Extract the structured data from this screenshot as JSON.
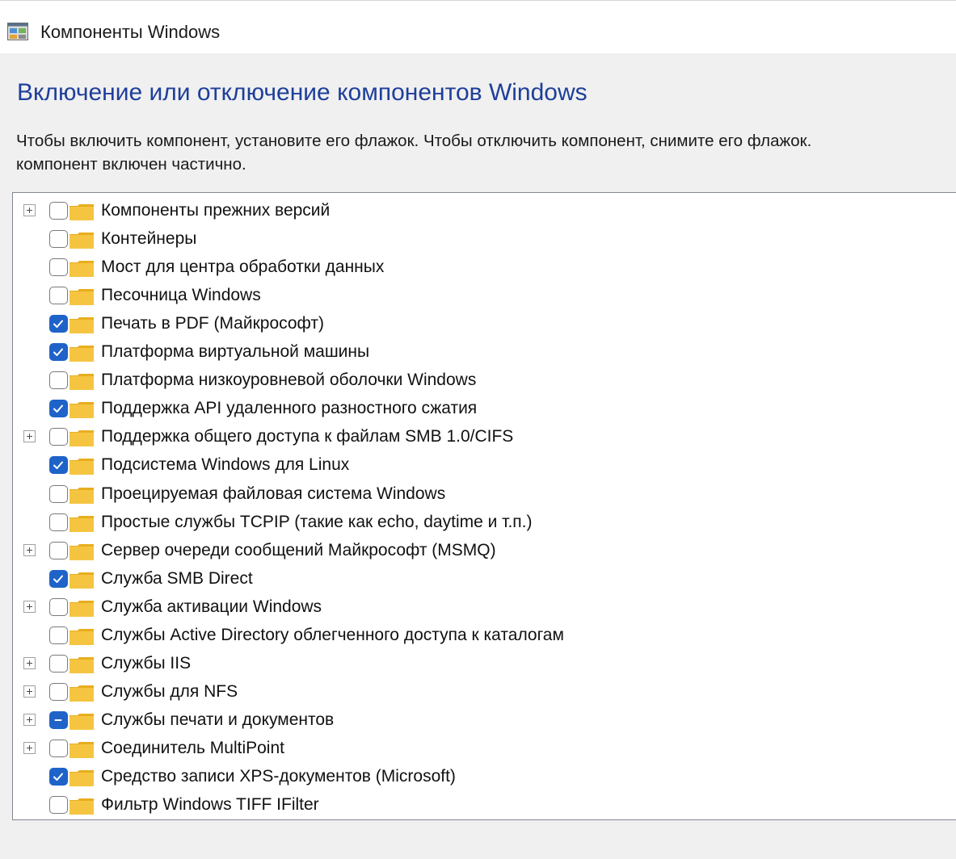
{
  "window": {
    "title": "Компоненты Windows",
    "icon": "windows-features-icon"
  },
  "heading": "Включение или отключение компонентов Windows",
  "description": {
    "line1": "Чтобы включить компонент, установите его флажок. Чтобы отключить компонент, снимите его флажок.",
    "line2": "компонент включен частично."
  },
  "colors": {
    "heading": "#1e3f9a",
    "checkbox_checked": "#1f63c9",
    "folder": "#f5c542"
  },
  "features": [
    {
      "label": "Компоненты прежних версий",
      "expandable": true,
      "state": "unchecked"
    },
    {
      "label": "Контейнеры",
      "expandable": false,
      "state": "unchecked"
    },
    {
      "label": "Мост для центра обработки данных",
      "expandable": false,
      "state": "unchecked"
    },
    {
      "label": "Песочница Windows",
      "expandable": false,
      "state": "unchecked"
    },
    {
      "label": "Печать в PDF (Майкрософт)",
      "expandable": false,
      "state": "checked"
    },
    {
      "label": "Платформа виртуальной машины",
      "expandable": false,
      "state": "checked"
    },
    {
      "label": "Платформа низкоуровневой оболочки Windows",
      "expandable": false,
      "state": "unchecked"
    },
    {
      "label": "Поддержка API удаленного разностного сжатия",
      "expandable": false,
      "state": "checked"
    },
    {
      "label": "Поддержка общего доступа к файлам SMB 1.0/CIFS",
      "expandable": true,
      "state": "unchecked"
    },
    {
      "label": "Подсистема Windows для Linux",
      "expandable": false,
      "state": "checked"
    },
    {
      "label": "Проецируемая файловая система Windows",
      "expandable": false,
      "state": "unchecked"
    },
    {
      "label": "Простые службы TCPIP (такие как echo, daytime и т.п.)",
      "expandable": false,
      "state": "unchecked"
    },
    {
      "label": "Сервер очереди сообщений Майкрософт (MSMQ)",
      "expandable": true,
      "state": "unchecked"
    },
    {
      "label": "Служба SMB Direct",
      "expandable": false,
      "state": "checked"
    },
    {
      "label": "Служба активации Windows",
      "expandable": true,
      "state": "unchecked"
    },
    {
      "label": "Службы Active Directory облегченного доступа к каталогам",
      "expandable": false,
      "state": "unchecked"
    },
    {
      "label": "Службы IIS",
      "expandable": true,
      "state": "unchecked"
    },
    {
      "label": "Службы для NFS",
      "expandable": true,
      "state": "unchecked"
    },
    {
      "label": "Службы печати и документов",
      "expandable": true,
      "state": "partial"
    },
    {
      "label": "Соединитель MultiPoint",
      "expandable": true,
      "state": "unchecked"
    },
    {
      "label": "Средство записи XPS-документов (Microsoft)",
      "expandable": false,
      "state": "checked"
    },
    {
      "label": "Фильтр Windows TIFF IFilter",
      "expandable": false,
      "state": "unchecked"
    }
  ]
}
